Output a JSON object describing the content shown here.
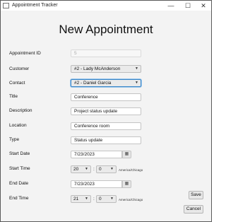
{
  "window": {
    "title": "Appointment Tracker",
    "min_glyph": "—",
    "max_glyph": "☐",
    "close_glyph": "✕"
  },
  "page": {
    "heading": "New Appointment"
  },
  "form": {
    "appointment_id": {
      "label": "Appointment ID",
      "value": "5"
    },
    "customer": {
      "label": "Customer",
      "value": "#2 - Lady McAnderson"
    },
    "contact": {
      "label": "Contact",
      "value": "#2 - Daniel Garcia"
    },
    "title": {
      "label": "Title",
      "value": "Conference"
    },
    "description": {
      "label": "Description",
      "value": "Project status update"
    },
    "location": {
      "label": "Location",
      "value": "Conference room"
    },
    "type": {
      "label": "Type",
      "value": "Status update"
    },
    "start_date": {
      "label": "Start Date",
      "value": "7/23/2023"
    },
    "start_time": {
      "label": "Start Time",
      "hour": "20",
      "minute": "0",
      "separator": ":",
      "timezone": "America/Chicago"
    },
    "end_date": {
      "label": "End Date",
      "value": "7/23/2023"
    },
    "end_time": {
      "label": "End Time",
      "hour": "21",
      "minute": "0",
      "separator": ":",
      "timezone": "America/Chicago"
    }
  },
  "icons": {
    "dropdown_arrow": "▼",
    "calendar": "▦"
  },
  "buttons": {
    "save": "Save",
    "cancel": "Cancel"
  }
}
